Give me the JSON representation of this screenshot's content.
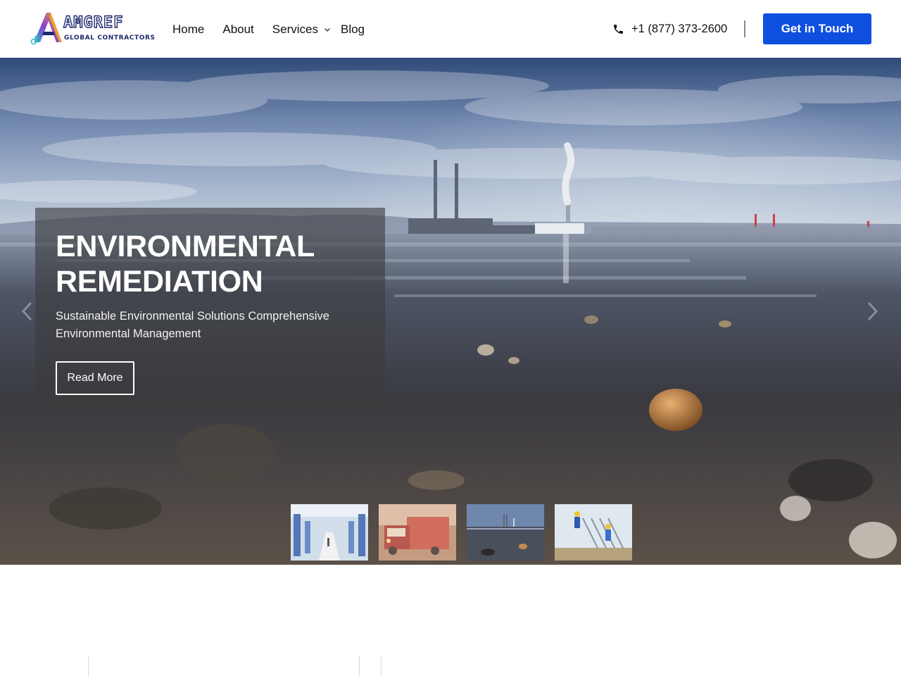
{
  "brand": {
    "name": "AMGREF",
    "tagline": "GLOBAL CONTRACTORS",
    "colors": {
      "primary": "#1d2a6b",
      "accent_orange": "#f5a623",
      "accent_purple": "#8b3fd1",
      "accent_teal": "#2bb7c9"
    }
  },
  "nav": {
    "items": [
      {
        "label": "Home"
      },
      {
        "label": "About"
      },
      {
        "label": "Services",
        "has_dropdown": true,
        "icon": "chevron-down-icon"
      },
      {
        "label": "Blog"
      }
    ]
  },
  "contact": {
    "phone": "+1 (877) 373-2600",
    "phone_icon": "phone-icon",
    "cta_label": "Get in Touch",
    "cta_color": "#0f4fe0"
  },
  "hero": {
    "title": "ENVIRONMENTAL REMEDIATION",
    "subtitle": "Sustainable Environmental Solutions Comprehensive Environmental Management",
    "button_label": "Read More",
    "prev_icon": "chevron-left-icon",
    "next_icon": "chevron-right-icon",
    "active_slide": 3,
    "thumbnails": [
      {
        "subject": "warehouse"
      },
      {
        "subject": "truck"
      },
      {
        "subject": "coastal-industrial"
      },
      {
        "subject": "construction-workers"
      }
    ]
  }
}
